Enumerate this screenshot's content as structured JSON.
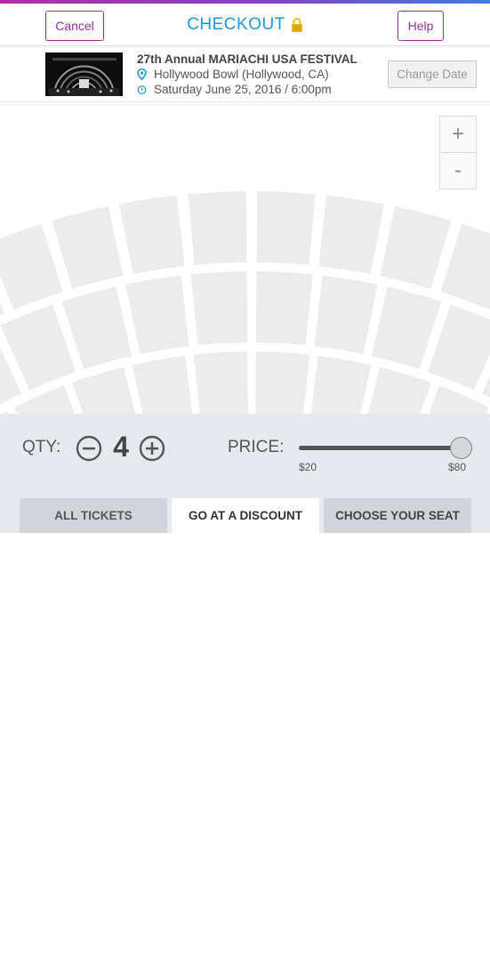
{
  "header": {
    "cancel_label": "Cancel",
    "title": "CHECKOUT",
    "help_label": "Help"
  },
  "event": {
    "title": "27th Annual MARIACHI USA FESTIVAL",
    "venue": "Hollywood Bowl (Hollywood, CA)",
    "datetime": "Saturday June 25, 2016 / 6:00pm",
    "change_date_label": "Change Date"
  },
  "map": {
    "zoom_in_label": "+",
    "zoom_out_label": "-"
  },
  "controls": {
    "qty_label": "QTY:",
    "qty_value": "4",
    "price_label": "PRICE:",
    "price_min": "$20",
    "price_max": "$80",
    "price_selected_fraction": 1.0
  },
  "tabs": [
    {
      "label": "ALL TICKETS",
      "active": false
    },
    {
      "label": "GO AT A DISCOUNT",
      "active": true
    },
    {
      "label": "CHOOSE YOUR SEAT",
      "active": false
    }
  ],
  "colors": {
    "accent_purple": "#9b2fa0",
    "title_blue": "#1d98d8",
    "lock_gold": "#e8b800",
    "controls_bg": "#e6eaee",
    "seat_section": "#ececec"
  }
}
